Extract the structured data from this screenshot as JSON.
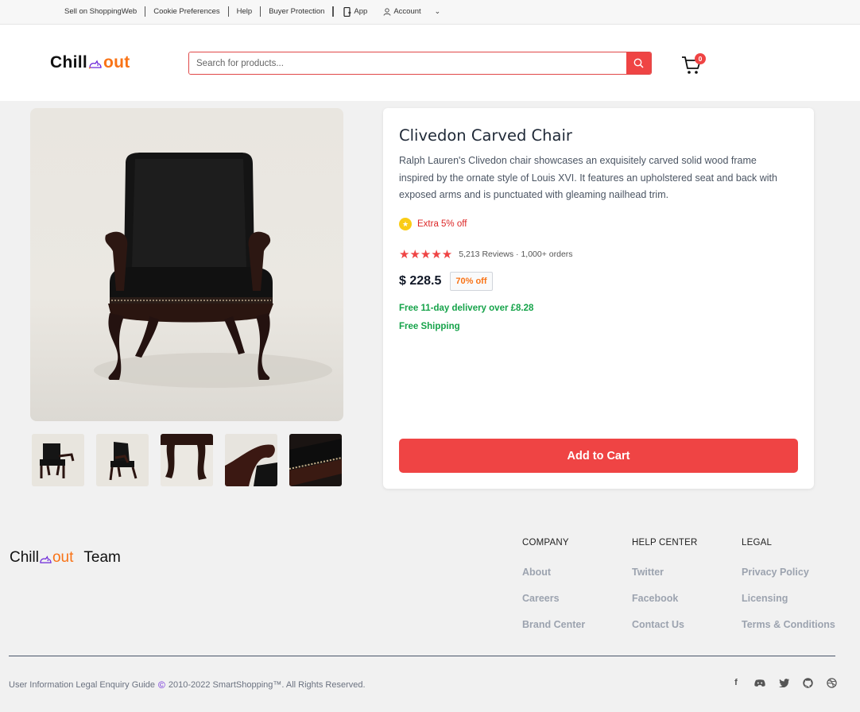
{
  "topbar": {
    "links": [
      "Sell on ShoppingWeb",
      "Cookie Preferences",
      "Help",
      "Buyer Protection"
    ],
    "app_label": "App",
    "account_label": "Account"
  },
  "header": {
    "logo_left": "Chill",
    "logo_right": "out",
    "search_placeholder": "Search for products...",
    "cart_count": "0"
  },
  "product": {
    "title": "Clivedon Carved Chair",
    "description": "Ralph Lauren's Clivedon chair showcases an exquisitely carved solid wood frame inspired by the ornate style of Louis XVI. It features an upholstered seat and back with exposed arms and is punctuated with gleaming nailhead trim.",
    "extra_discount": "Extra 5% off",
    "rating_stars": 5,
    "reviews_text": "5,213 Reviews · 1,000+ orders",
    "price": "$ 228.5",
    "discount_badge": "70% off",
    "delivery": "Free 11-day delivery over £8.28",
    "shipping": "Free Shipping",
    "add_to_cart": "Add to Cart",
    "thumbnail_count": 5
  },
  "footer": {
    "logo_left": "Chill",
    "logo_right": "out",
    "team": "Team",
    "columns": [
      {
        "heading": "COMPANY",
        "items": [
          "About",
          "Careers",
          "Brand Center"
        ]
      },
      {
        "heading": "HELP CENTER",
        "items": [
          "Twitter",
          "Facebook",
          "Contact Us"
        ]
      },
      {
        "heading": "LEGAL",
        "items": [
          "Privacy Policy",
          "Licensing",
          "Terms & Conditions"
        ]
      }
    ],
    "bottom_links": "User Information Legal Enquiry Guide",
    "copyright": "2010-2022 SmartShopping™. All Rights Reserved.",
    "socials": [
      "facebook-icon",
      "discord-icon",
      "twitter-icon",
      "github-icon",
      "dribbble-icon"
    ]
  },
  "colors": {
    "accent": "#ef4444",
    "logo_orange": "#f97316",
    "success": "#16a34a"
  }
}
